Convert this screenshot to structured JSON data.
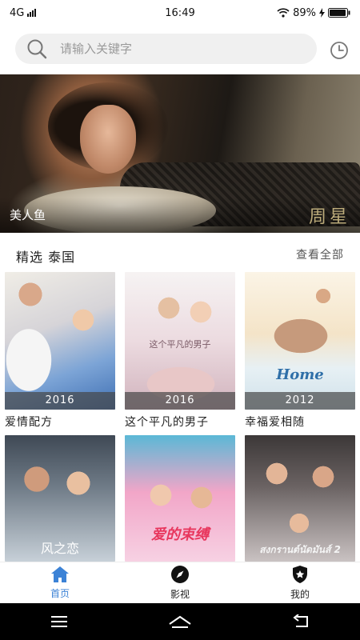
{
  "status_bar": {
    "network": "4G",
    "time": "16:49",
    "battery": "89%"
  },
  "search": {
    "placeholder": "请输入关键字"
  },
  "banner": {
    "title": "美人鱼",
    "logo_text": "周星"
  },
  "section": {
    "title": "精选 泰国",
    "more_label": "查看全部"
  },
  "movies": [
    {
      "name": "爱情配方",
      "year": "2016",
      "poster_text": ""
    },
    {
      "name": "这个平凡的男子",
      "year": "2016",
      "poster_text": "这个平凡的男子"
    },
    {
      "name": "幸福爱相随",
      "year": "2012",
      "poster_text": "Home"
    },
    {
      "name": "",
      "year": "",
      "poster_text": "风之恋"
    },
    {
      "name": "",
      "year": "",
      "poster_text": "爱的束缚"
    },
    {
      "name": "",
      "year": "",
      "poster_text": "สงกรานต์นัดมันส์ 2"
    }
  ],
  "tabs": [
    {
      "label": "首页",
      "icon": "home-icon",
      "active": true
    },
    {
      "label": "影视",
      "icon": "compass-icon",
      "active": false
    },
    {
      "label": "我的",
      "icon": "shield-star-icon",
      "active": false
    }
  ],
  "colors": {
    "accent": "#3b82d6",
    "nav_bar": "#000000",
    "search_bg": "#f0f0f0"
  }
}
